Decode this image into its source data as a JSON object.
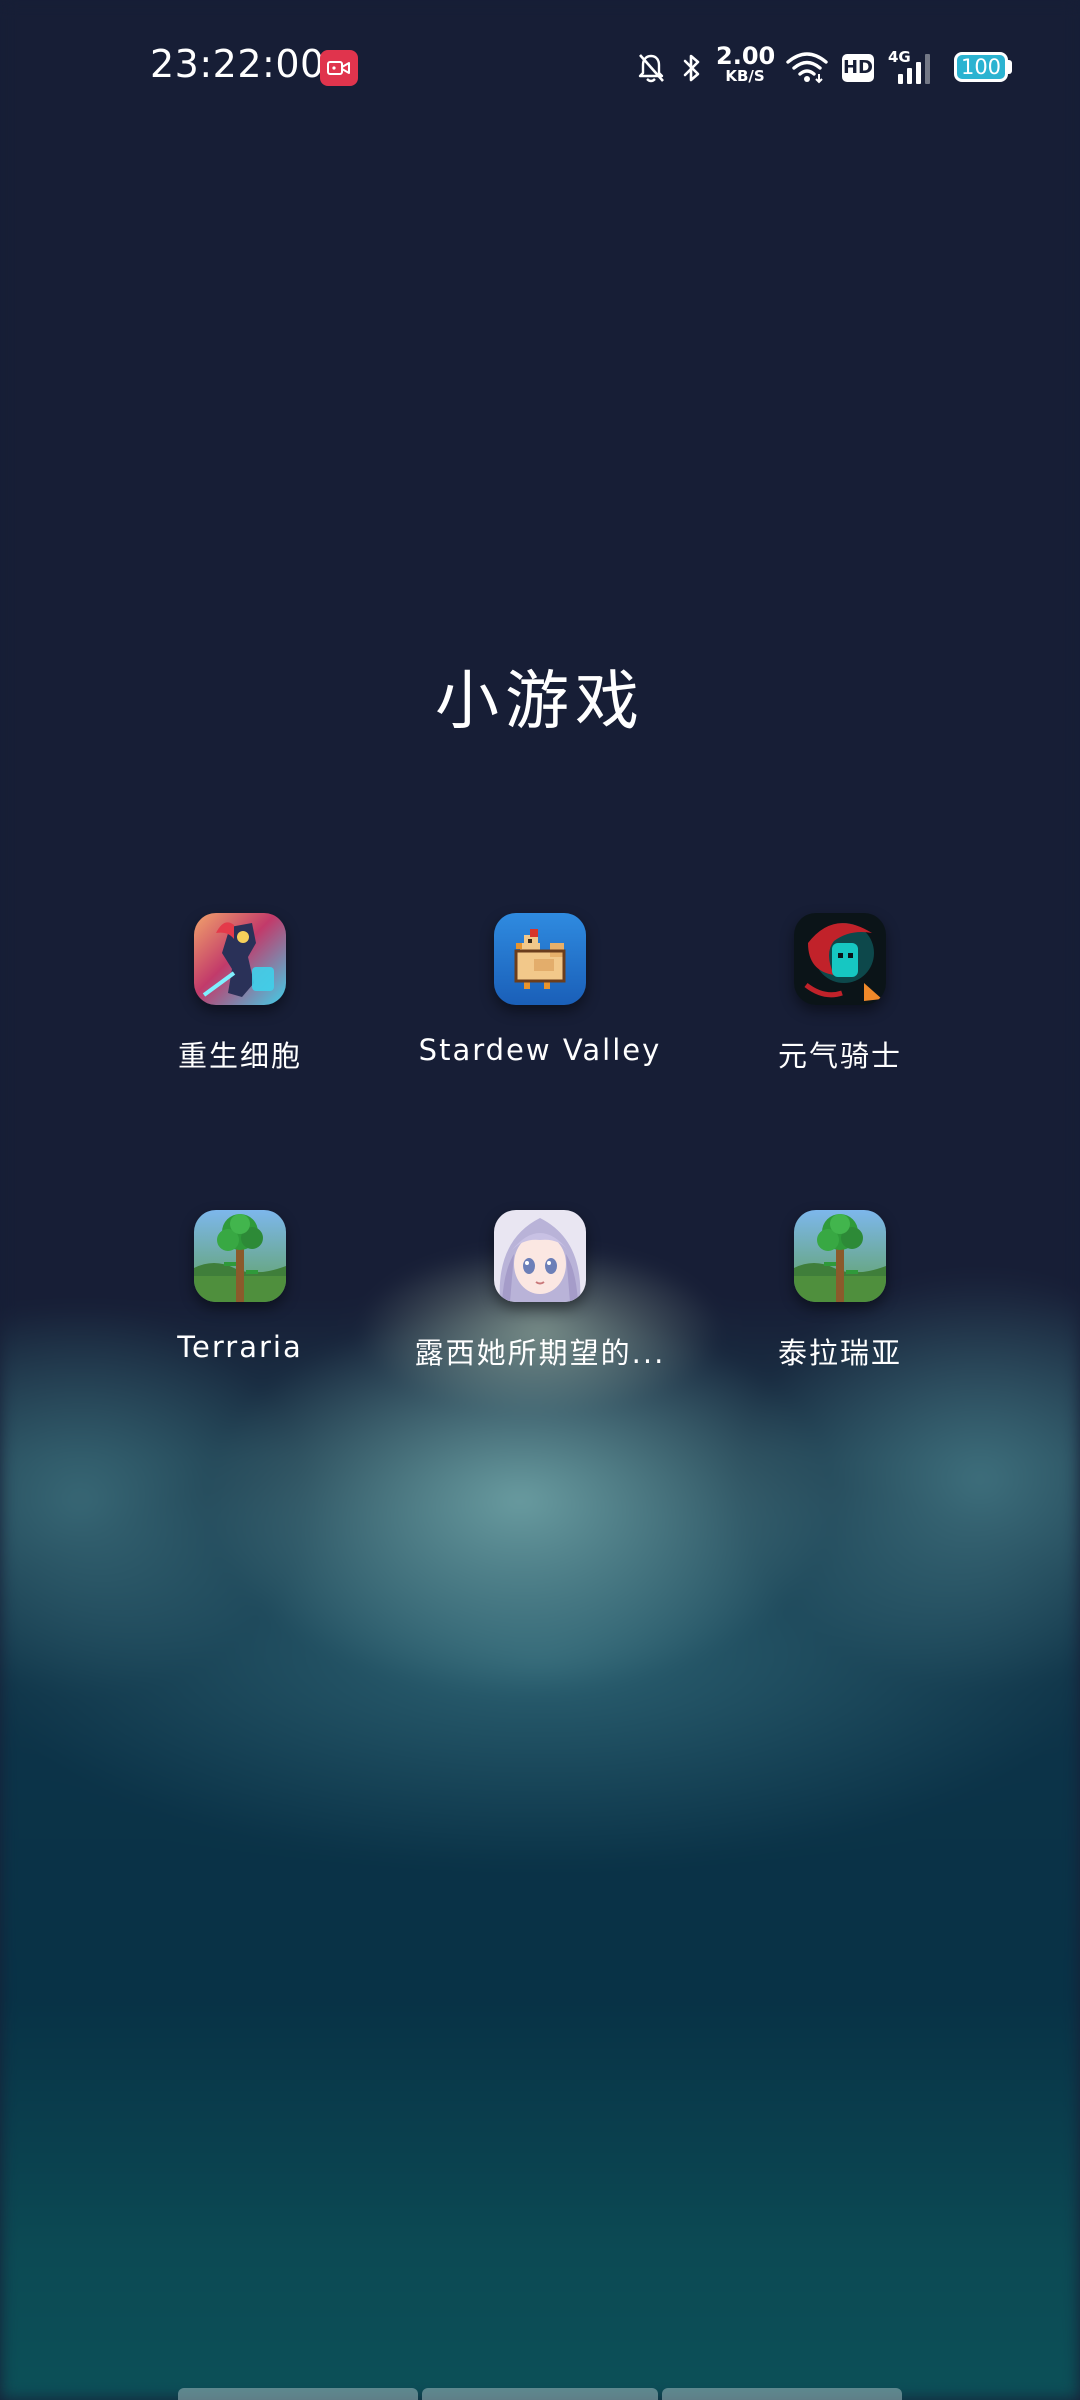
{
  "status_bar": {
    "time": "23:22:00",
    "net_speed_value": "2.00",
    "net_speed_unit": "KB/S",
    "hd_badge": "HD",
    "network_type": "4G",
    "battery_level": "100",
    "battery_color": "#2bb3d1",
    "recording_color": "#e0344d",
    "icons": [
      "screen-record-icon",
      "mute-bell-icon",
      "bluetooth-icon",
      "wifi-icon",
      "hd-icon",
      "signal-icon",
      "battery-icon"
    ]
  },
  "folder": {
    "title": "小游戏",
    "apps": [
      {
        "label": "重生细胞",
        "icon": "dead-cells-icon"
      },
      {
        "label": "Stardew Valley",
        "icon": "stardew-valley-chicken-icon"
      },
      {
        "label": "元气骑士",
        "icon": "soul-knight-icon"
      },
      {
        "label": "Terraria",
        "icon": "terraria-tree-icon"
      },
      {
        "label": "露西她所期望的...",
        "icon": "anime-girl-icon"
      },
      {
        "label": "泰拉瑞亚",
        "icon": "terraria-tree-icon"
      }
    ]
  },
  "colors": {
    "background_top": "#171e36",
    "background_bottom": "#0c5058"
  }
}
